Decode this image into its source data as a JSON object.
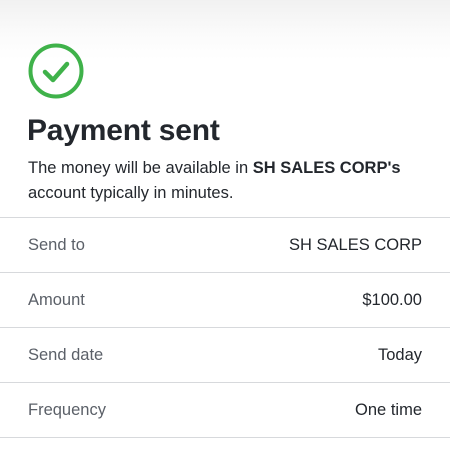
{
  "status": {
    "icon": "check-circle-icon",
    "color": "#3fb24a"
  },
  "title": "Payment sent",
  "message": {
    "prefix": "The money will be available in ",
    "recipient_possessive": "SH SALES CORP's",
    "suffix": " account typically in minutes."
  },
  "details": [
    {
      "label": "Send to",
      "value": "SH SALES CORP"
    },
    {
      "label": "Amount",
      "value": "$100.00"
    },
    {
      "label": "Send date",
      "value": "Today"
    },
    {
      "label": "Frequency",
      "value": "One time"
    }
  ]
}
